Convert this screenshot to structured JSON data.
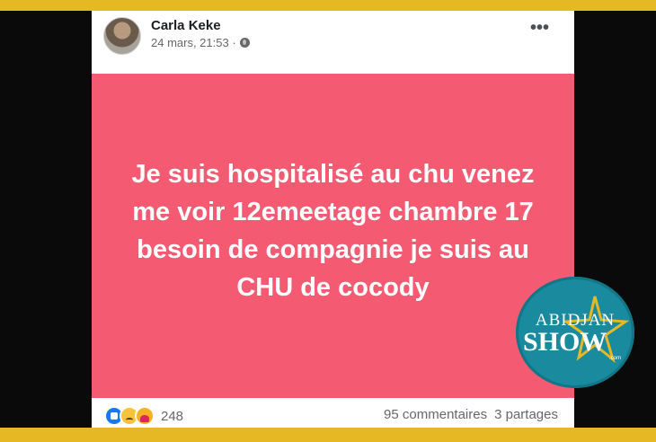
{
  "post": {
    "author": "Carla Keke",
    "timestamp": "24 mars, 21:53 ·",
    "privacy_icon": "globe-icon",
    "more_label": "•••",
    "status_text": "Je suis hospitalisé au chu venez me voir 12emeetage chambre 17 besoin de compagnie je suis au CHU de cocody",
    "status_bg": "#f45a71"
  },
  "footer": {
    "reaction_icons": [
      "like-icon",
      "sad-icon",
      "care-icon"
    ],
    "reaction_count": "248",
    "comments": "95 commentaires",
    "shares": "3 partages"
  },
  "watermark": {
    "line1": "ABIDJAN",
    "line2": "SHOW",
    "suffix": ".com"
  },
  "colors": {
    "frame": "#e5b824",
    "badge": "#1a8a9e",
    "star": "#e5b824"
  }
}
